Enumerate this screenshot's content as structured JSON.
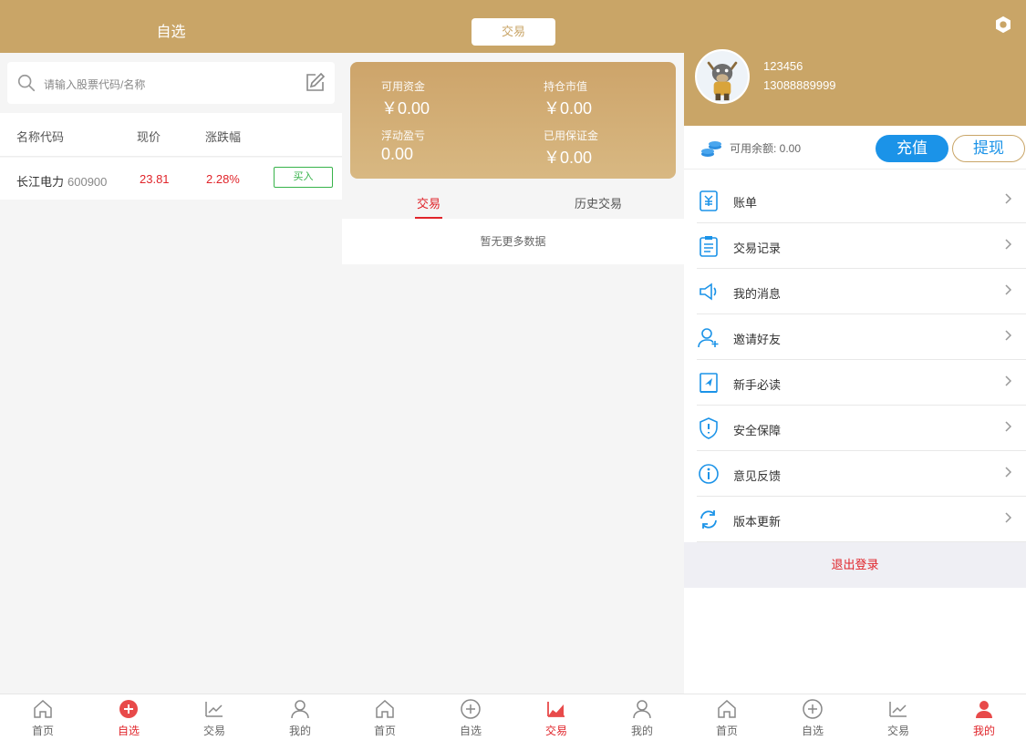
{
  "colors": {
    "brand": "#c9a567",
    "up_red": "#e0242a",
    "buy_green": "#37b34a",
    "recharge_blue": "#1b93e8",
    "icon_blue": "#1b93e8"
  },
  "watchlist": {
    "header_title": "自选",
    "search_placeholder": "请输入股票代码/名称",
    "search_icon": "search-icon",
    "edit_icon": "edit-icon",
    "columns": [
      "名称代码",
      "现价",
      "涨跌幅"
    ],
    "rows": [
      {
        "name": "长江电力",
        "code": "600900",
        "price": "23.81",
        "change": "2.28%",
        "action": "买入"
      }
    ]
  },
  "trade": {
    "header_tab": "交易",
    "assets": [
      {
        "label": "可用资金",
        "value": "￥0.00"
      },
      {
        "label": "持仓市值",
        "value": "￥0.00"
      },
      {
        "label": "浮动盈亏",
        "value": "0.00"
      },
      {
        "label": "已用保证金",
        "value": "￥0.00"
      }
    ],
    "sub_tabs": [
      "交易",
      "历史交易"
    ],
    "active_sub_tab": "交易",
    "empty_text": "暂无更多数据"
  },
  "mine": {
    "username": "123456",
    "phone": "13088889999",
    "balance_text": "可用余额: 0.00",
    "recharge_label": "充值",
    "withdraw_label": "提现",
    "menu": [
      {
        "label": "账单",
        "icon": "bill-icon"
      },
      {
        "label": "交易记录",
        "icon": "clipboard-icon"
      },
      {
        "label": "我的消息",
        "icon": "speaker-icon"
      },
      {
        "label": "邀请好友",
        "icon": "add-user-icon"
      },
      {
        "label": "新手必读",
        "icon": "guide-book-icon"
      },
      {
        "label": "安全保障",
        "icon": "shield-icon"
      },
      {
        "label": "意见反馈",
        "icon": "info-icon"
      },
      {
        "label": "版本更新",
        "icon": "refresh-icon"
      }
    ],
    "logout_label": "退出登录"
  },
  "tabbar": {
    "tabs": [
      "首页",
      "自选",
      "交易",
      "我的"
    ],
    "active": {
      "panel1": "自选",
      "panel2": "交易",
      "panel3": "我的"
    }
  }
}
